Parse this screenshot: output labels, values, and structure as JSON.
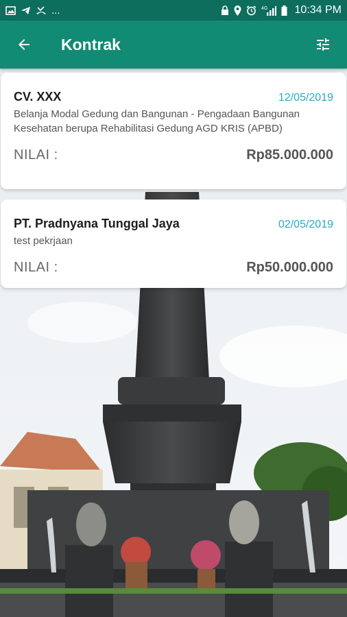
{
  "status_bar": {
    "left_icons": [
      "image-icon",
      "telegram-icon",
      "missed-call-icon"
    ],
    "more": "...",
    "right_icons": [
      "lock-icon",
      "location-icon",
      "alarm-icon",
      "4g-signal-icon",
      "battery-icon"
    ],
    "time": "10:34 PM"
  },
  "app_bar": {
    "title": "Kontrak",
    "back_icon": "arrow-left-icon",
    "filter_icon": "tune-icon"
  },
  "contracts": [
    {
      "company": "CV. XXX",
      "date": "12/05/2019",
      "description": "Belanja Modal Gedung dan Bangunan - Pengadaan Bangunan Kesehatan berupa Rehabilitasi Gedung AGD KRIS (APBD)",
      "nilai_label": "NILAI :",
      "nilai_value": "Rp85.000.000"
    },
    {
      "company": "PT. Pradnyana Tunggal Jaya",
      "date": "02/05/2019",
      "description": "test pekrjaan",
      "nilai_label": "NILAI :",
      "nilai_value": "Rp50.000.000"
    }
  ],
  "colors": {
    "status_bar": "#0d6e5d",
    "app_bar": "#118b73",
    "date": "#2aa9c4"
  }
}
